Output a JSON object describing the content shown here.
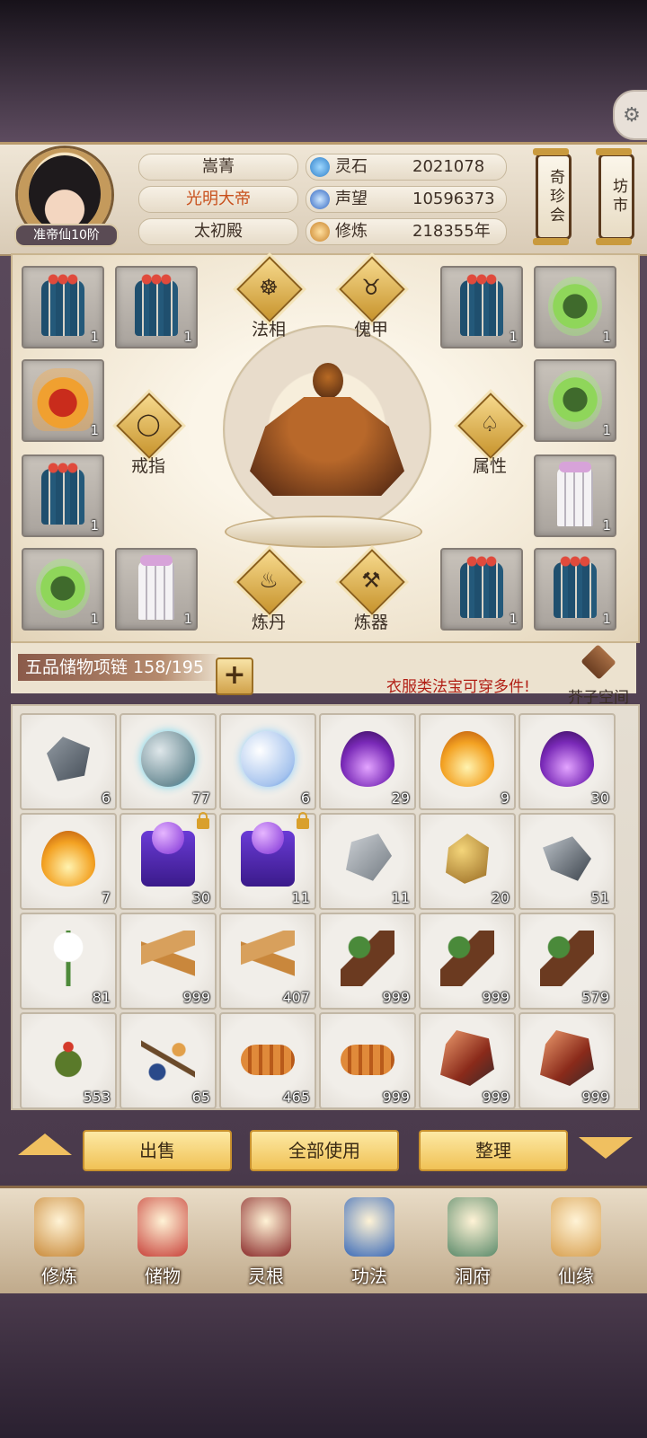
{
  "player": {
    "rank": "准帝仙10阶",
    "name": "嵩菁",
    "title": "光明大帝",
    "sect": "太初殿"
  },
  "stats": [
    {
      "label": "灵石",
      "value": "2021078",
      "icon": "spirit-stone-icon",
      "color": "#4a9fd8"
    },
    {
      "label": "声望",
      "value": "10596373",
      "icon": "prestige-crystal-icon",
      "color": "#3b7fd0"
    },
    {
      "label": "修炼",
      "value": "218355年",
      "icon": "meditation-icon",
      "color": "#d89a3a"
    }
  ],
  "side_buttons": {
    "treasure_hall": "奇珍会",
    "market": "坊市"
  },
  "equip": {
    "actions": {
      "dharma": "法相",
      "puppet": "傀甲",
      "ring": "戒指",
      "attributes": "属性",
      "alchemy": "炼丹",
      "forging": "炼器"
    },
    "slots_left": [
      {
        "item": "blue-robe",
        "count": "1"
      },
      {
        "item": "blue-robe",
        "count": "1"
      },
      {
        "item": "flame-robe",
        "count": "1"
      },
      {
        "item": "blue-robe",
        "count": "1"
      },
      {
        "item": "green-robe",
        "count": "1"
      },
      {
        "item": "white-robe",
        "count": "1"
      }
    ],
    "slots_right": [
      {
        "item": "blue-robe",
        "count": "1"
      },
      {
        "item": "green-robe",
        "count": "1"
      },
      {
        "item": "green-robe",
        "count": "1"
      },
      {
        "item": "white-robe",
        "count": "1"
      },
      {
        "item": "blue-robe",
        "count": "1"
      },
      {
        "item": "blue-robe",
        "count": "1"
      }
    ]
  },
  "bag": {
    "name": "五品储物项链 158/195",
    "hint": "衣服类法宝可穿多件!",
    "space_label": "芥子空间",
    "items": [
      {
        "type": "ore",
        "count": "6"
      },
      {
        "type": "orb",
        "count": "77"
      },
      {
        "type": "orb-light",
        "count": "6"
      },
      {
        "type": "flame-purple",
        "count": "29"
      },
      {
        "type": "flame-gold",
        "count": "9"
      },
      {
        "type": "flame-purple",
        "count": "30"
      },
      {
        "type": "flame-gold",
        "count": "7"
      },
      {
        "type": "box",
        "count": "30",
        "locked": true
      },
      {
        "type": "box",
        "count": "11",
        "locked": true
      },
      {
        "type": "ore-light",
        "count": "11"
      },
      {
        "type": "ore-gold",
        "count": "20"
      },
      {
        "type": "ore-dark",
        "count": "51"
      },
      {
        "type": "flower",
        "count": "81"
      },
      {
        "type": "root",
        "count": "999"
      },
      {
        "type": "root",
        "count": "407"
      },
      {
        "type": "herb",
        "count": "999"
      },
      {
        "type": "herb",
        "count": "999"
      },
      {
        "type": "herb",
        "count": "579"
      },
      {
        "type": "weed",
        "count": "553"
      },
      {
        "type": "fruit",
        "count": "65"
      },
      {
        "type": "worm",
        "count": "465"
      },
      {
        "type": "worm",
        "count": "999"
      },
      {
        "type": "crystal",
        "count": "999"
      },
      {
        "type": "crystal",
        "count": "999"
      }
    ]
  },
  "buttons": {
    "sell": "出售",
    "use_all": "全部使用",
    "sort": "整理"
  },
  "nav": [
    {
      "label": "修炼",
      "icon": "cultivation-icon",
      "color": "#c98a3a"
    },
    {
      "label": "储物",
      "icon": "storage-bag-icon",
      "color": "#c8423a"
    },
    {
      "label": "灵根",
      "icon": "spirit-root-icon",
      "color": "#8a2a2a"
    },
    {
      "label": "功法",
      "icon": "skill-book-icon",
      "color": "#3a6ab8"
    },
    {
      "label": "洞府",
      "icon": "cave-mansion-icon",
      "color": "#5a8a6a"
    },
    {
      "label": "仙缘",
      "icon": "immortal-fate-icon",
      "color": "#d8a050"
    }
  ]
}
